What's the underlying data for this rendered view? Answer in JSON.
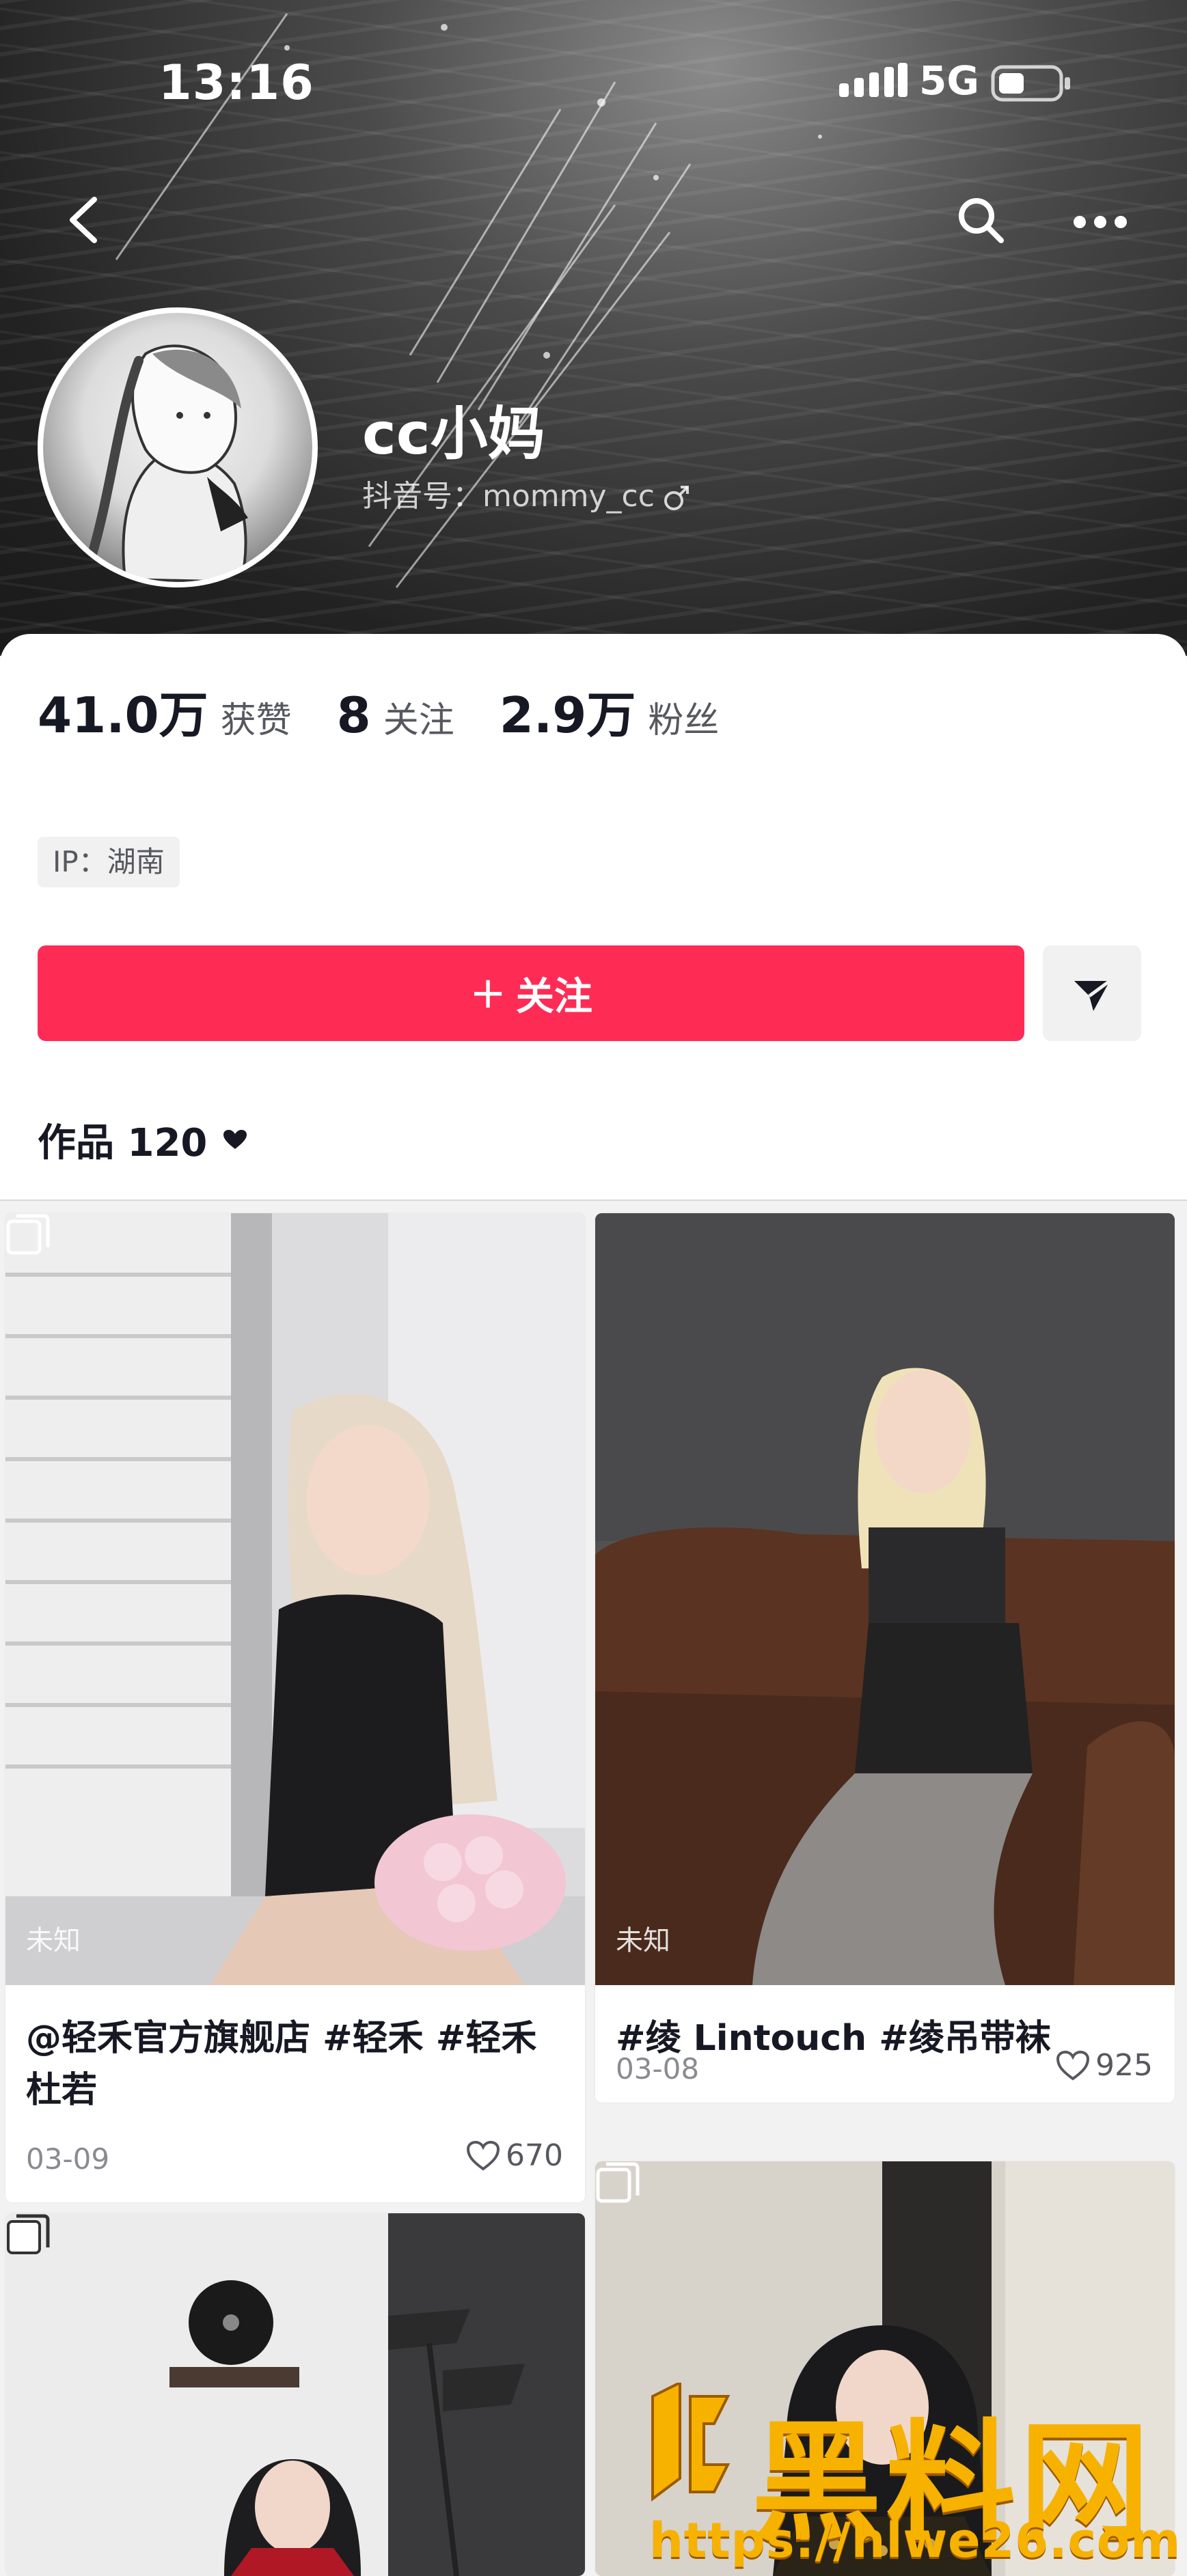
{
  "status_bar": {
    "time": "13:16",
    "network": "5G",
    "icons": [
      "signal-icon",
      "battery-icon"
    ]
  },
  "nav": {
    "icons": [
      "back-icon",
      "search-icon",
      "more-icon"
    ]
  },
  "profile": {
    "name": "cc小妈",
    "douyin_id": "抖音号：mommy_cc",
    "gender_icon": "male-icon",
    "avatar_icon": "avatar-illustration"
  },
  "stats": [
    {
      "value": "41.0万",
      "label": "获赞"
    },
    {
      "value": "8",
      "label": "关注"
    },
    {
      "value": "2.9万",
      "label": "粉丝"
    }
  ],
  "ip": "IP：湖南",
  "follow_button": {
    "plus": "+",
    "label": "关注"
  },
  "dm_icon": "send-icon",
  "works_tab": {
    "label": "作品 120",
    "icon": "heart-icon"
  },
  "videos": [
    {
      "title": "@轻禾官方旗舰店 #轻禾 #轻禾杜若",
      "date": "03-09",
      "likes": "670",
      "watermark": "未知",
      "multi": true
    },
    {
      "title": "#绫 Lintouch #绫吊带袜",
      "date": "03-08",
      "likes": "925",
      "watermark": "未知",
      "multi": false
    },
    {
      "title": "",
      "date": "",
      "likes": "",
      "watermark": "",
      "multi": true
    },
    {
      "title": "",
      "date": "",
      "likes": "",
      "watermark": "",
      "multi": true
    }
  ],
  "site_watermark": {
    "name": "黑料网",
    "url": "https://hlwe26.com"
  },
  "colors": {
    "accent": "#fe2c55",
    "watermark": "#f7b200"
  }
}
